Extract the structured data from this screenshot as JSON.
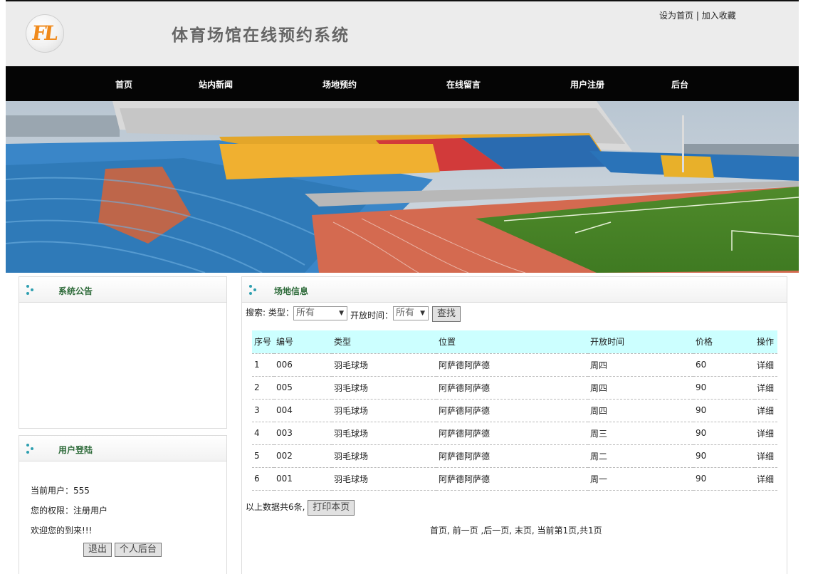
{
  "header": {
    "logo_text": "FL",
    "title": "体育场馆在线预约系统",
    "links": {
      "set_home": "设为首页",
      "separator": "|",
      "add_favorite": "加入收藏"
    }
  },
  "nav": {
    "items": [
      "首页",
      "站内新闻",
      "场地预约",
      "在线留言",
      "用户注册",
      "后台"
    ]
  },
  "banner": {
    "icon": "stadium-banner-image"
  },
  "notice_panel": {
    "title": "系统公告"
  },
  "login_panel": {
    "title": "用户登陆",
    "current_user_label": "当前用户：",
    "current_user": "555",
    "permission_label": "您的权限：",
    "permission": "注册用户",
    "welcome": "欢迎您的到来!!!",
    "logout_button": "退出",
    "backend_button": "个人后台"
  },
  "venue_panel": {
    "title": "场地信息",
    "search": {
      "label": "搜索:",
      "type_label": "类型：",
      "type_value": "所有",
      "time_label": "开放时间：",
      "time_value": "所有",
      "button": "查找"
    },
    "table": {
      "headers": [
        "序号",
        "编号",
        "类型",
        "位置",
        "开放时间",
        "价格",
        "操作"
      ],
      "rows": [
        [
          "1",
          "006",
          "羽毛球场",
          "阿萨德阿萨德",
          "周四",
          "60",
          "详细"
        ],
        [
          "2",
          "005",
          "羽毛球场",
          "阿萨德阿萨德",
          "周四",
          "90",
          "详细"
        ],
        [
          "3",
          "004",
          "羽毛球场",
          "阿萨德阿萨德",
          "周四",
          "90",
          "详细"
        ],
        [
          "4",
          "003",
          "羽毛球场",
          "阿萨德阿萨德",
          "周三",
          "90",
          "详细"
        ],
        [
          "5",
          "002",
          "羽毛球场",
          "阿萨德阿萨德",
          "周二",
          "90",
          "详细"
        ],
        [
          "6",
          "001",
          "羽毛球场",
          "阿萨德阿萨德",
          "周一",
          "90",
          "详细"
        ]
      ]
    },
    "total_text": "以上数据共6条,",
    "print_button": "打印本页",
    "pager": "首页, 前一页 ,后一页, 末页, 当前第1页,共1页"
  },
  "colors": {
    "nav_bg": "#050505",
    "header_bg": "#ececec",
    "table_header_bg": "#ccffff",
    "panel_title": "#2e6b3a",
    "accent_dots": "#2e9fb0"
  }
}
